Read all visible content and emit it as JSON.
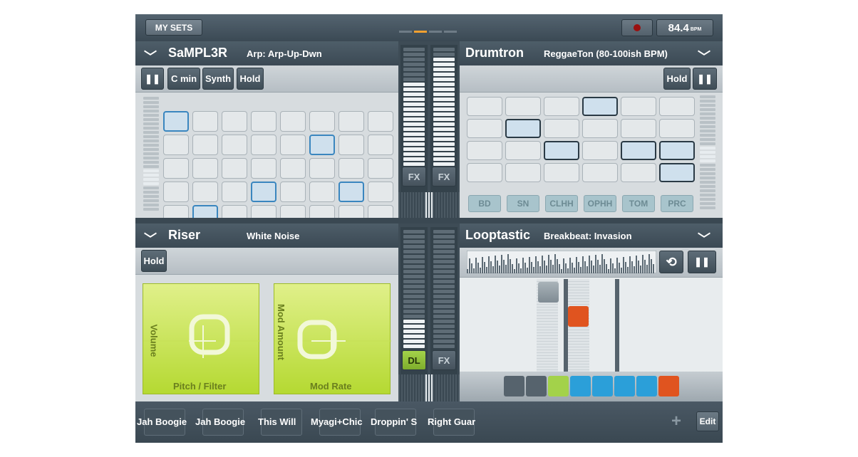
{
  "topbar": {
    "my_sets_label": "MY SETS",
    "bpm_value": "84.4",
    "bpm_unit": "BPM"
  },
  "panels": {
    "sampler": {
      "title": "SaMPL3R",
      "subtitle": "Arp: Arp-Up-Dwn",
      "buttons": {
        "key": "C min",
        "mode": "Synth",
        "hold": "Hold"
      }
    },
    "drumtron": {
      "title": "Drumtron",
      "subtitle": "ReggaeTon (80-100ish BPM)",
      "hold": "Hold",
      "rows": [
        "BD",
        "SN",
        "CLHH",
        "OPHH",
        "TOM",
        "PRC"
      ]
    },
    "riser": {
      "title": "Riser",
      "subtitle": "White Noise",
      "hold": "Hold",
      "pad1_y": "Volume",
      "pad1_x": "Pitch / Filter",
      "pad2_y": "Mod Amount",
      "pad2_x": "Mod Rate"
    },
    "looptastic": {
      "title": "Looptastic",
      "subtitle": "Breakbeat: Invasion"
    }
  },
  "mixer": {
    "fx": "FX",
    "dl": "DL"
  },
  "bottombar": {
    "slots": [
      "Jah Boogie",
      "Jah Boogie",
      "This Will",
      "Myagi+Chic",
      "Droppin' S",
      "Right Guar"
    ],
    "edit_label": "Edit"
  },
  "colors": {
    "accent_green": "#a3d24a",
    "accent_blue": "#3a86bf",
    "accent_orange": "#e0541f",
    "clip_blue": "#2b9fd9",
    "page_active": "#f0a030"
  }
}
